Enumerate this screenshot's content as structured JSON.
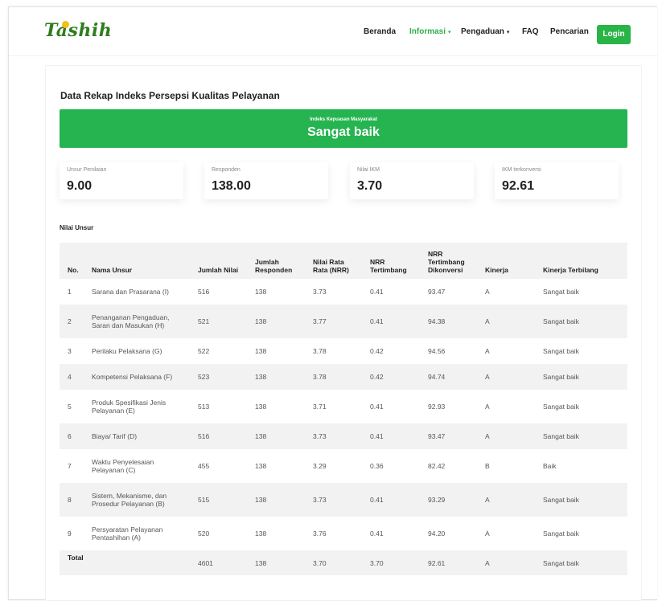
{
  "brand": {
    "logo_text": "Tashih",
    "primary_color": "#28b446",
    "logo_color": "#2e7d1e"
  },
  "nav": {
    "items": [
      {
        "label": "Beranda",
        "active": false,
        "dropdown": false
      },
      {
        "label": "Informasi",
        "active": true,
        "dropdown": true
      },
      {
        "label": "Pengaduan",
        "active": false,
        "dropdown": true
      },
      {
        "label": "FAQ",
        "active": false,
        "dropdown": false
      },
      {
        "label": "Pencarian",
        "active": false,
        "dropdown": false
      }
    ],
    "login_label": "Login",
    "caret": "▾"
  },
  "page": {
    "title": "Data Rekap Indeks Persepsi Kualitas Pelayanan",
    "banner": {
      "subtitle": "Indeks Kepuasan Masyarakat",
      "value": "Sangat baik"
    },
    "stats": [
      {
        "label": "Unsur Penilaian",
        "value": "9.00"
      },
      {
        "label": "Responden",
        "value": "138.00"
      },
      {
        "label": "Nilai IKM",
        "value": "3.70"
      },
      {
        "label": "IKM terkonversi",
        "value": "92.61"
      }
    ],
    "section_label": "Nilai Unsur"
  },
  "table": {
    "headers": [
      "No.",
      "Nama Unsur",
      "Jumlah Nilai",
      "Jumlah Responden",
      "Nilai Rata Rata (NRR)",
      "NRR Tertimbang",
      "NRR Tertimbang Dikonversi",
      "Kinerja",
      "Kinerja Terbilang"
    ],
    "rows": [
      [
        "1",
        "Sarana dan Prasarana (I)",
        "516",
        "138",
        "3.73",
        "0.41",
        "93.47",
        "A",
        "Sangat baik"
      ],
      [
        "2",
        "Penanganan Pengaduan, Saran dan Masukan (H)",
        "521",
        "138",
        "3.77",
        "0.41",
        "94.38",
        "A",
        "Sangat baik"
      ],
      [
        "3",
        "Perilaku Pelaksana (G)",
        "522",
        "138",
        "3.78",
        "0.42",
        "94.56",
        "A",
        "Sangat baik"
      ],
      [
        "4",
        "Kompetensi Pelaksana (F)",
        "523",
        "138",
        "3.78",
        "0.42",
        "94.74",
        "A",
        "Sangat baik"
      ],
      [
        "5",
        "Produk Spesifikasi Jenis Pelayanan (E)",
        "513",
        "138",
        "3.71",
        "0.41",
        "92.93",
        "A",
        "Sangat baik"
      ],
      [
        "6",
        "Biaya/ Tarif (D)",
        "516",
        "138",
        "3.73",
        "0.41",
        "93.47",
        "A",
        "Sangat baik"
      ],
      [
        "7",
        "Waktu Penyelesaian Pelayanan (C)",
        "455",
        "138",
        "3.29",
        "0.36",
        "82.42",
        "B",
        "Baik"
      ],
      [
        "8",
        "Sistem, Mekanisme, dan Prosedur Pelayanan (B)",
        "515",
        "138",
        "3.73",
        "0.41",
        "93.29",
        "A",
        "Sangat baik"
      ],
      [
        "9",
        "Persyaratan Pelayanan Pentashihan (A)",
        "520",
        "138",
        "3.76",
        "0.41",
        "94.20",
        "A",
        "Sangat baik"
      ]
    ],
    "total": {
      "label": "Total",
      "cells": [
        "4601",
        "138",
        "3.70",
        "3.70",
        "92.61",
        "A",
        "Sangat baik"
      ]
    }
  }
}
